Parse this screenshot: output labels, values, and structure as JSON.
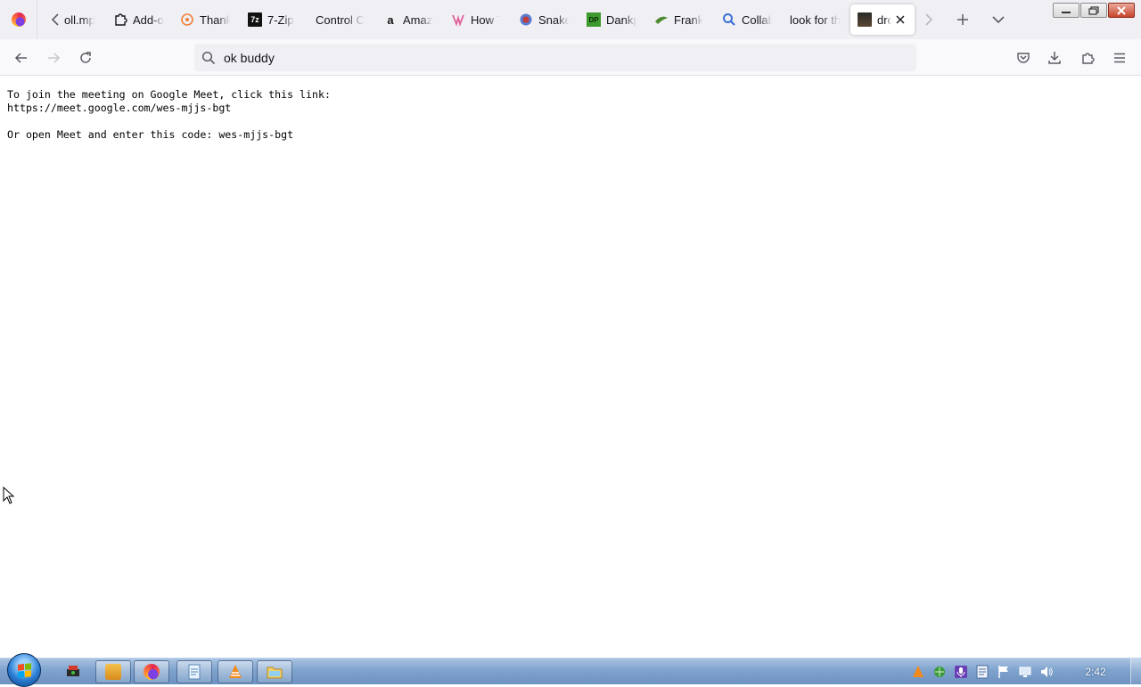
{
  "browser": {
    "tabs": [
      {
        "label": "oll.mp",
        "icon": "music-file-icon"
      },
      {
        "label": "Add-o",
        "icon": "puzzle-icon"
      },
      {
        "label": "Thank",
        "icon": "thanks-icon"
      },
      {
        "label": "7-Zip",
        "icon": "7zip-icon",
        "icon_text": "7z"
      },
      {
        "label": "Control C",
        "icon": "none"
      },
      {
        "label": "Amaz",
        "icon": "amazon-icon",
        "icon_text": "a"
      },
      {
        "label": "How T",
        "icon": "how-icon"
      },
      {
        "label": "Snake",
        "icon": "snake-icon"
      },
      {
        "label": "Dankp",
        "icon": "dankpods-icon",
        "icon_text": "DP"
      },
      {
        "label": "Frank",
        "icon": "frank-icon"
      },
      {
        "label": "Collab",
        "icon": "search-icon"
      },
      {
        "label": "look for th",
        "icon": "none"
      },
      {
        "label": "dro",
        "icon": "page-thumbnail-icon",
        "active": true
      }
    ],
    "url_bar": {
      "value": "ok buddy"
    }
  },
  "page": {
    "lines": [
      "To join the meeting on Google Meet, click this link:",
      "https://meet.google.com/wes-mjjs-bgt",
      "",
      "Or open Meet and enter this code: wes-mjjs-bgt"
    ]
  },
  "taskbar": {
    "clock": "2:42",
    "pinned": [
      "app-icon",
      "folder-app-icon",
      "firefox-icon",
      "notepad-icon",
      "vlc-icon",
      "file-explorer-icon"
    ]
  },
  "colors": {
    "tabstrip_bg": "#f0f0f4",
    "navbar_bg": "#f9f9fb",
    "taskbar_blue": "#7fa3cd"
  }
}
